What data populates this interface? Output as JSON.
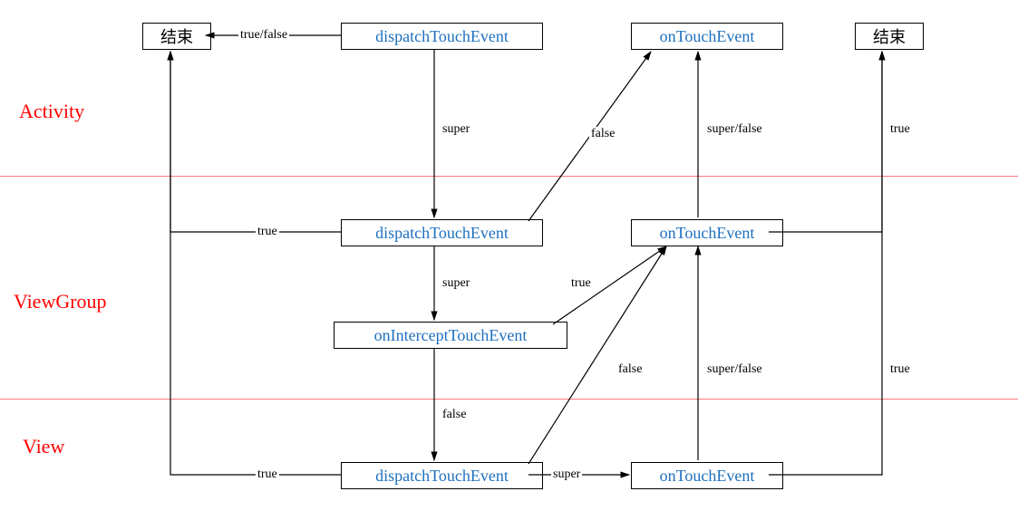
{
  "rows": {
    "activity": "Activity",
    "viewgroup": "ViewGroup",
    "view": "View"
  },
  "nodes": {
    "end1": "结束",
    "end2": "结束",
    "act_dispatch": "dispatchTouchEvent",
    "act_ontouch": "onTouchEvent",
    "vg_dispatch": "dispatchTouchEvent",
    "vg_intercept": "onInterceptTouchEvent",
    "vg_ontouch": "onTouchEvent",
    "v_dispatch": "dispatchTouchEvent",
    "v_ontouch": "onTouchEvent"
  },
  "edges": {
    "act_dispatch_end": "true/false",
    "act_dispatch_vg": "super",
    "vg_dispatch_end": "true",
    "vg_dispatch_act_ontouch": "false",
    "vg_dispatch_intercept": "super",
    "vg_intercept_vg_ontouch": "true",
    "vg_intercept_v_dispatch": "false",
    "vg_ontouch_act_ontouch": "super/false",
    "vg_ontouch_end2": "true",
    "v_dispatch_end": "true",
    "v_dispatch_vg_ontouch": "false",
    "v_dispatch_v_ontouch": "super",
    "v_ontouch_vg_ontouch": "super/false",
    "v_ontouch_end2": "true"
  }
}
